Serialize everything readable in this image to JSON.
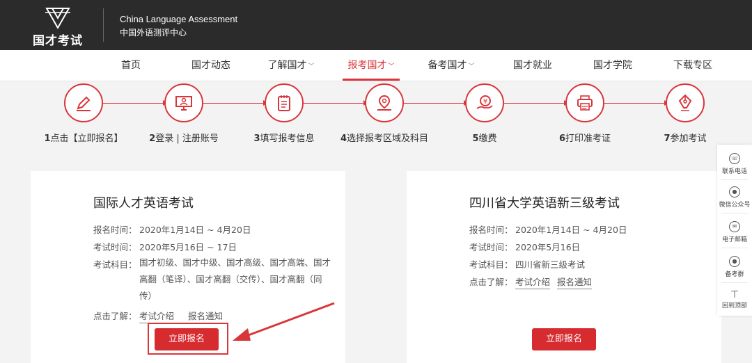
{
  "header": {
    "logo_text": "国才考试",
    "brand_en": "China Language Assessment",
    "brand_cn": "中国外语测评中心"
  },
  "nav": {
    "items": [
      {
        "label": "首页",
        "dropdown": false
      },
      {
        "label": "国才动态",
        "dropdown": false
      },
      {
        "label": "了解国才",
        "dropdown": true
      },
      {
        "label": "报考国才",
        "dropdown": true,
        "active": true
      },
      {
        "label": "备考国才",
        "dropdown": true
      },
      {
        "label": "国才就业",
        "dropdown": false
      },
      {
        "label": "国才学院",
        "dropdown": false
      },
      {
        "label": "下载专区",
        "dropdown": false
      }
    ]
  },
  "steps": [
    {
      "num": "1",
      "text": "点击【立即报名】",
      "icon": "edit-icon"
    },
    {
      "num": "2",
      "text": "登录 | 注册账号",
      "icon": "computer-user-icon"
    },
    {
      "num": "3",
      "text": "填写报考信息",
      "icon": "notepad-icon"
    },
    {
      "num": "4",
      "text": "选择报考区域及科目",
      "icon": "map-pin-icon"
    },
    {
      "num": "5",
      "text": "缴费",
      "icon": "yen-coin-hand-icon"
    },
    {
      "num": "6",
      "text": "打印准考证",
      "icon": "printer-icon"
    },
    {
      "num": "7",
      "text": "参加考试",
      "icon": "pen-nib-icon"
    }
  ],
  "cards": [
    {
      "title": "国际人才英语考试",
      "reg_label": "报名时间：",
      "reg_value": "2020年1月14日 ~ 4月20日",
      "exam_label": "考试时间：",
      "exam_value": "2020年5月16日 ~ 17日",
      "subject_label": "考试科目：",
      "subject_value": "国才初级、国才中级、国才高级、国才高端、国才高翻（笔译）、国才高翻（交传）、国才高翻（同传）",
      "more_label": "点击了解：",
      "link1": "考试介绍",
      "link2": "报名通知",
      "button": "立即报名"
    },
    {
      "title": "四川省大学英语新三级考试",
      "reg_label": "报名时间：",
      "reg_value": "2020年1月14日 ~ 4月20日",
      "exam_label": "考试时间：",
      "exam_value": "2020年5月16日",
      "subject_label": "考试科目：",
      "subject_value": "四川省新三级考试",
      "more_label": "点击了解：",
      "link1": "考试介绍",
      "link2": "报名通知",
      "button": "立即报名"
    }
  ],
  "sidebar": {
    "items": [
      {
        "label": "联系电话",
        "icon": "phone-icon"
      },
      {
        "label": "微信公众号",
        "icon": "wechat-icon"
      },
      {
        "label": "电子邮箱",
        "icon": "mail-icon"
      },
      {
        "label": "备考群",
        "icon": "qq-icon"
      },
      {
        "label": "回到顶部",
        "icon": "back-to-top-icon"
      }
    ]
  },
  "colors": {
    "accent": "#d9353a",
    "header_bg": "#2b2b2b",
    "button": "#d62b2f"
  }
}
